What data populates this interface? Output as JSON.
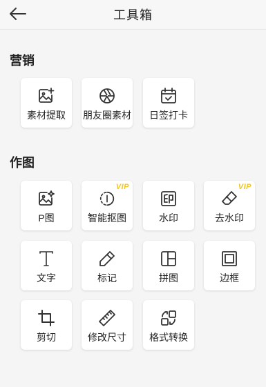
{
  "header": {
    "title": "工具箱",
    "back_icon": "arrow-left-icon"
  },
  "sections": [
    {
      "title": "营销",
      "tools": [
        {
          "label": "素材提取",
          "icon": "image-plus-icon"
        },
        {
          "label": "朋友圈素材",
          "icon": "aperture-icon"
        },
        {
          "label": "日签打卡",
          "icon": "calendar-check-icon"
        }
      ]
    },
    {
      "title": "作图",
      "tools": [
        {
          "label": "P图",
          "icon": "image-sparkle-icon"
        },
        {
          "label": "智能抠图",
          "icon": "cutout-icon",
          "badge": "VIP"
        },
        {
          "label": "水印",
          "icon": "stamp-icon"
        },
        {
          "label": "去水印",
          "icon": "eraser-icon",
          "badge": "VIP"
        },
        {
          "label": "文字",
          "icon": "text-t-icon"
        },
        {
          "label": "标记",
          "icon": "pencil-icon"
        },
        {
          "label": "拼图",
          "icon": "layout-icon"
        },
        {
          "label": "边框",
          "icon": "frame-icon"
        },
        {
          "label": "剪切",
          "icon": "crop-icon"
        },
        {
          "label": "修改尺寸",
          "icon": "ruler-icon"
        },
        {
          "label": "格式转换",
          "icon": "convert-icon"
        }
      ]
    }
  ],
  "colors": {
    "background": "#f5f5f5",
    "card": "#ffffff",
    "vip_badge": "#f5c518",
    "text": "#222222"
  }
}
